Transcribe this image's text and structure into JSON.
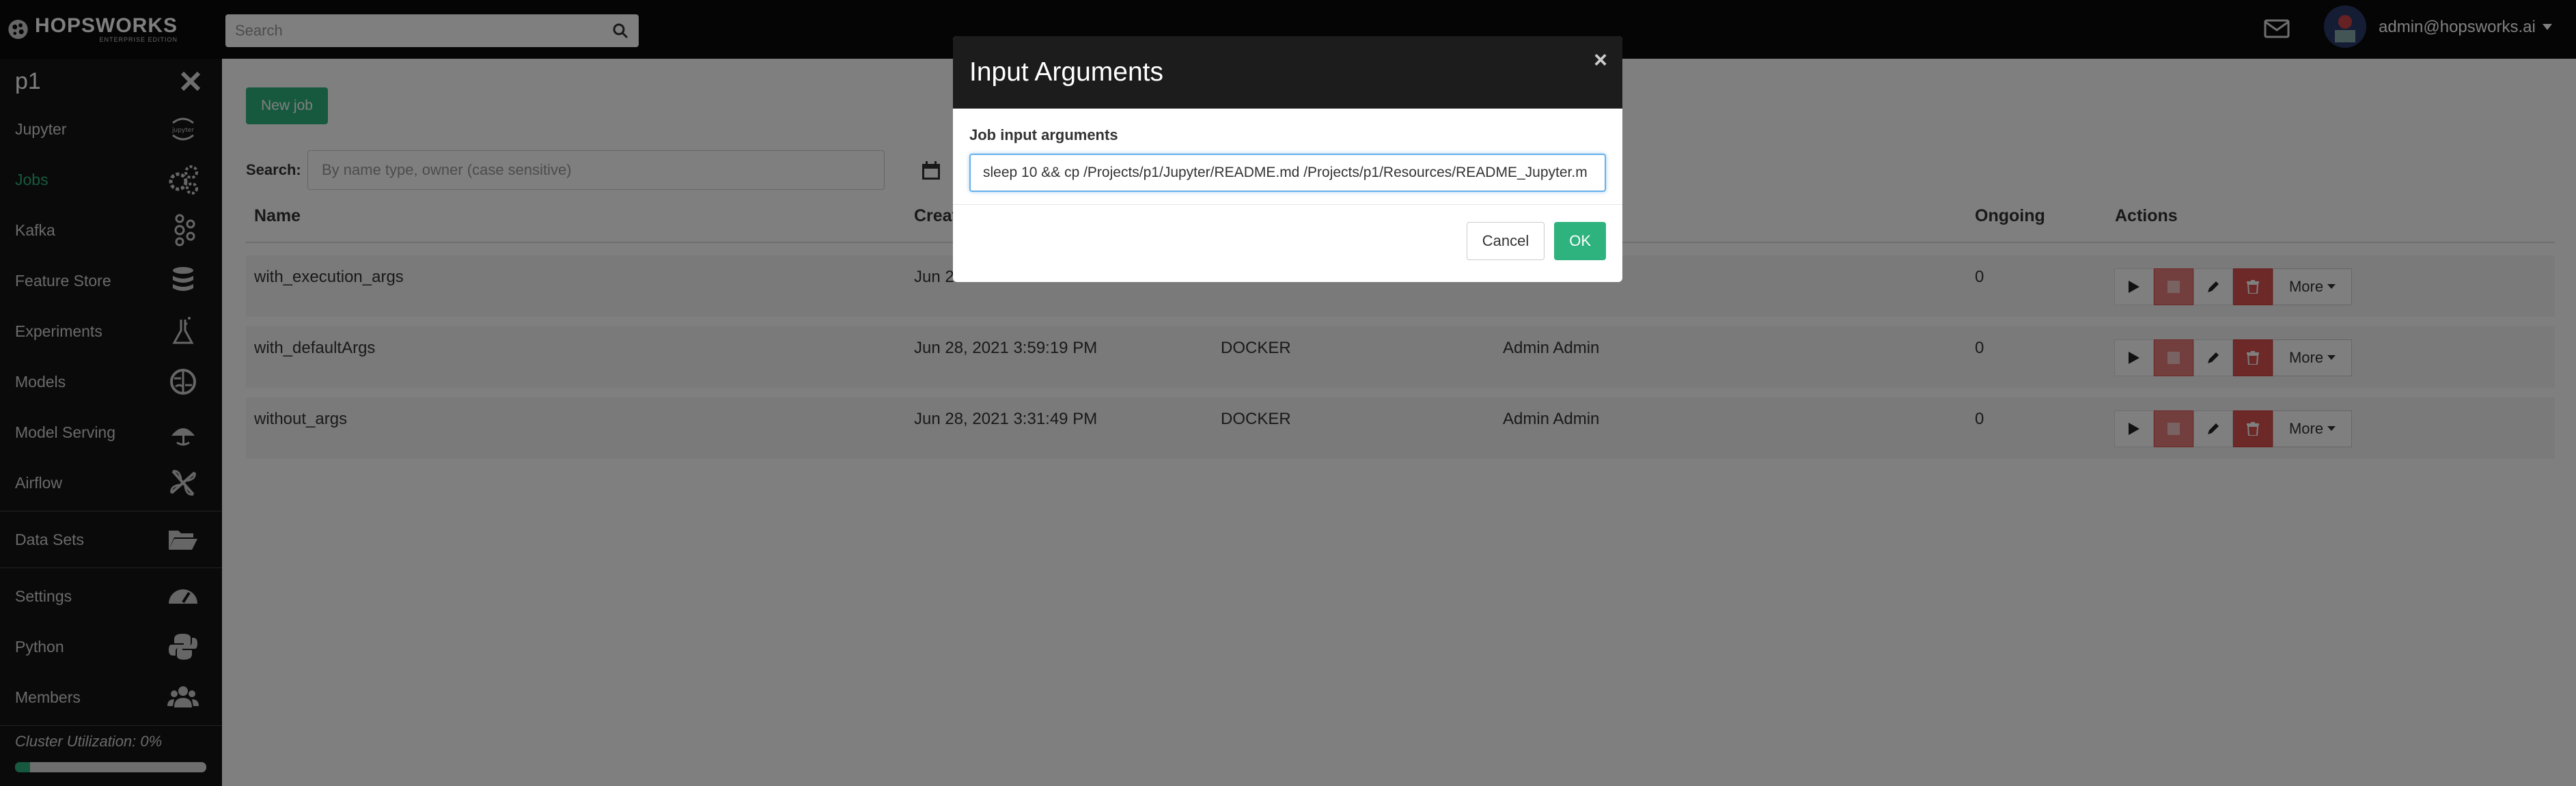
{
  "header": {
    "logo_text": "HOPSWORKS",
    "logo_subtext": "ENTERPRISE EDITION",
    "search_placeholder": "Search",
    "user_email": "admin@hopsworks.ai"
  },
  "sidebar": {
    "project_name": "p1",
    "items": [
      {
        "label": "Jupyter",
        "icon": "jupyter-icon"
      },
      {
        "label": "Jobs",
        "icon": "gears-icon",
        "active": true
      },
      {
        "label": "Kafka",
        "icon": "kafka-icon"
      },
      {
        "label": "Feature Store",
        "icon": "database-icon"
      },
      {
        "label": "Experiments",
        "icon": "flask-icon"
      },
      {
        "label": "Models",
        "icon": "brain-icon"
      },
      {
        "label": "Model Serving",
        "icon": "serving-icon"
      },
      {
        "label": "Airflow",
        "icon": "airflow-icon"
      },
      {
        "label": "Data Sets",
        "icon": "folder-open-icon"
      },
      {
        "label": "Settings",
        "icon": "dashboard-icon"
      },
      {
        "label": "Python",
        "icon": "python-icon"
      },
      {
        "label": "Members",
        "icon": "users-icon"
      }
    ],
    "cluster_utilization": "Cluster Utilization: 0%",
    "cluster_value": 0.08
  },
  "jobs": {
    "new_job_label": "New job",
    "search_label": "Search:",
    "search_placeholder": "By name type, owner (case sensitive)",
    "columns": {
      "name": "Name",
      "created": "Creat",
      "ongoing": "Ongoing",
      "actions": "Actions"
    },
    "rows": [
      {
        "name": "with_execution_args",
        "created": "Jun 2",
        "type": "",
        "owner": "",
        "ongoing": "0"
      },
      {
        "name": "with_defaultArgs",
        "created": "Jun 28, 2021 3:59:19 PM",
        "type": "DOCKER",
        "owner": "Admin Admin",
        "ongoing": "0"
      },
      {
        "name": "without_args",
        "created": "Jun 28, 2021 3:31:49 PM",
        "type": "DOCKER",
        "owner": "Admin Admin",
        "ongoing": "0"
      }
    ],
    "more_label": "More"
  },
  "modal": {
    "title": "Input Arguments",
    "close": "×",
    "label": "Job input arguments",
    "value": "sleep 10 && cp /Projects/p1/Jupyter/README.md /Projects/p1/Resources/README_Jupyter.m",
    "cancel": "Cancel",
    "ok": "OK"
  },
  "colors": {
    "accent": "#2fb37e",
    "danger": "#d9534f",
    "topbar": "#0a0a0a",
    "sidebar": "#141414"
  }
}
